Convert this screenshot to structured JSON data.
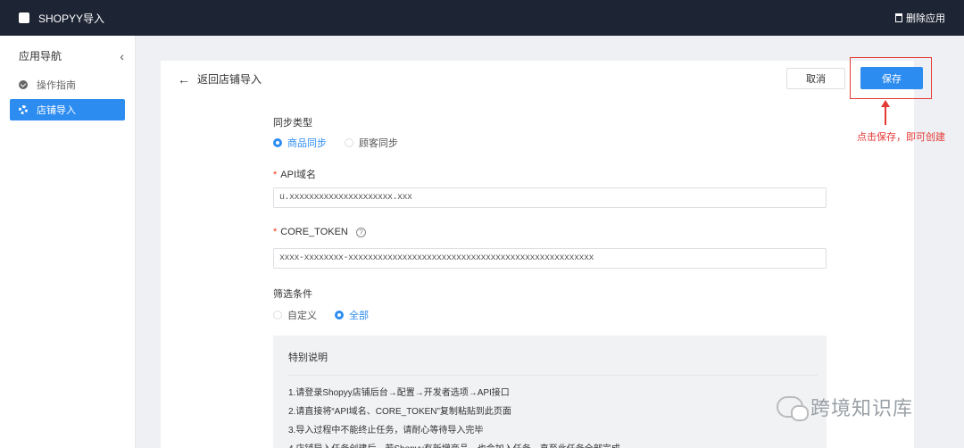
{
  "topbar": {
    "app_title": "SHOPYY导入",
    "delete_label": "删除应用"
  },
  "sidebar": {
    "title": "应用导航",
    "items": [
      {
        "label": "操作指南",
        "icon": "check-circle-icon",
        "active": false
      },
      {
        "label": "店铺导入",
        "icon": "gear-icon",
        "active": true
      }
    ]
  },
  "header": {
    "back_label": "返回店铺导入",
    "cancel_label": "取消",
    "save_label": "保存"
  },
  "form": {
    "sync_type": {
      "label": "同步类型",
      "options": [
        "商品同步",
        "顾客同步"
      ],
      "selected": "商品同步"
    },
    "api_domain": {
      "label": "API域名",
      "value": "u.xxxxxxxxxxxxxxxxxxxxx.xxx"
    },
    "core_token": {
      "label": "CORE_TOKEN",
      "value": "xxxx-xxxxxxxx-xxxxxxxxxxxxxxxxxxxxxxxxxxxxxxxxxxxxxxxxxxxxxxxxxx"
    },
    "filter": {
      "label": "筛选条件",
      "options": [
        "自定义",
        "全部"
      ],
      "selected": "全部"
    }
  },
  "notice": {
    "title": "特别说明",
    "items": [
      "1.请登录Shopyy店铺后台→配置→开发者选项→API接口",
      "2.请直接将“API域名、CORE_TOKEN”复制粘贴到此页面",
      "3.导入过程中不能终止任务，请耐心等待导入完毕",
      "4.店铺导入任务创建后，若Shopyy有新增商品，也会加入任务，直至此任务全部完成"
    ]
  },
  "annotation": {
    "note": "点击保存，即可创建",
    "color": "#e53935"
  },
  "watermark": {
    "text": "跨境知识库"
  },
  "colors": {
    "primary": "#2d8cf0",
    "topbar": "#1d2434",
    "required": "#ed4014"
  }
}
